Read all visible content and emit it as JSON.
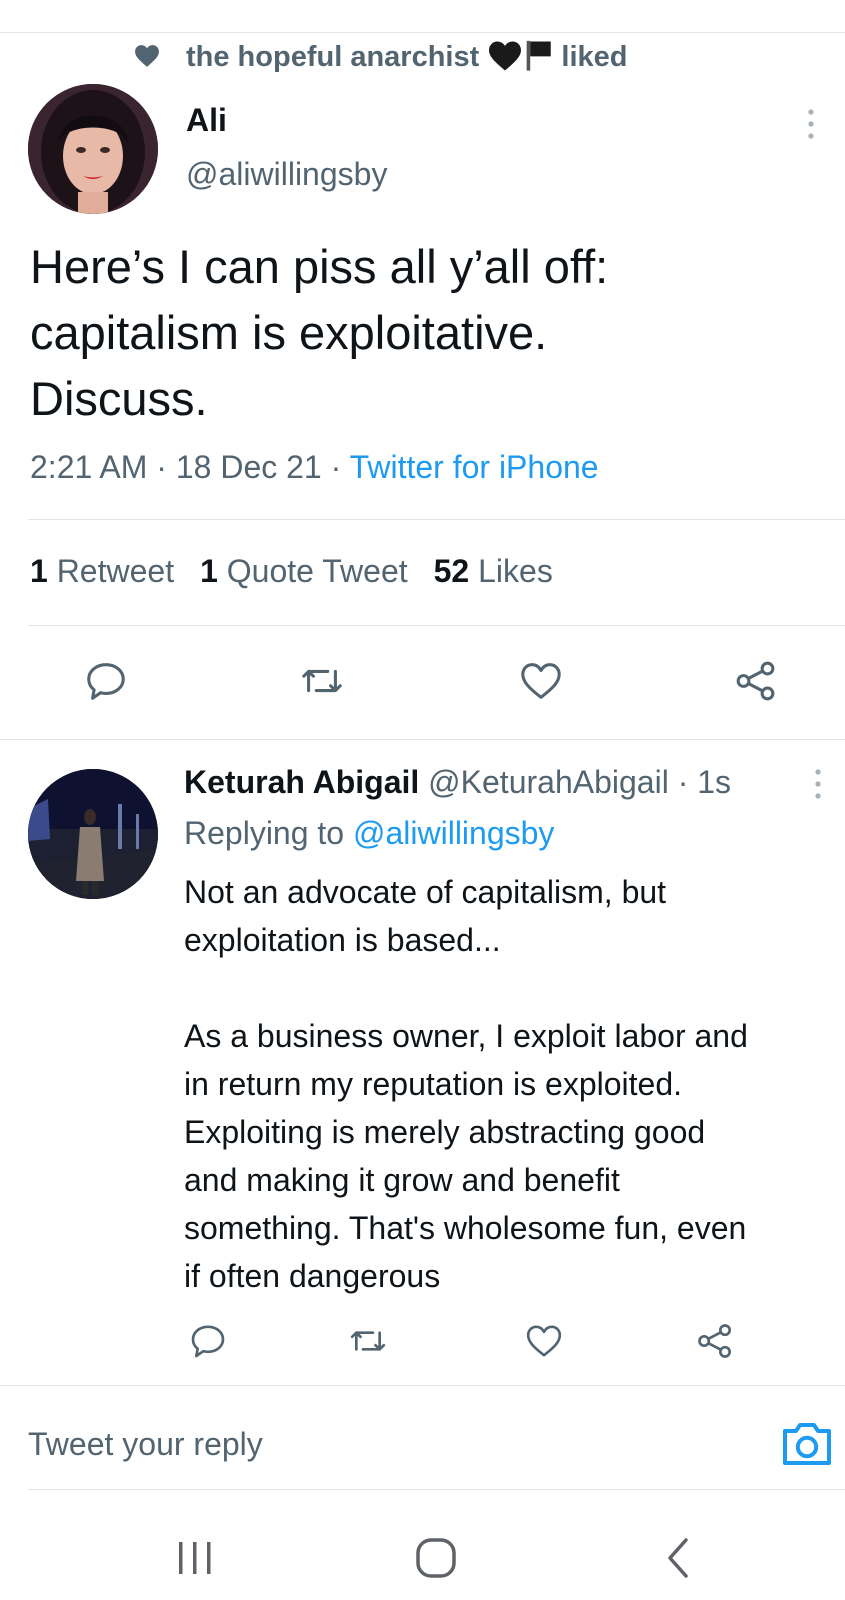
{
  "social_context": {
    "text": "the hopeful anarchist",
    "action": "liked"
  },
  "tweet": {
    "author_name": "Ali",
    "author_handle": "@aliwillingsby",
    "text_lines": [
      "Here’s I can piss all y’all off:",
      "capitalism is exploitative.",
      "Discuss."
    ],
    "time": "2:21 AM",
    "date": "18 Dec 21",
    "source": "Twitter for iPhone",
    "separator": " · ",
    "stats": {
      "retweets_count": "1",
      "retweets_label": "Retweet",
      "quotes_count": "1",
      "quotes_label": "Quote Tweet",
      "likes_count": "52",
      "likes_label": "Likes"
    }
  },
  "reply": {
    "author_name": "Keturah Abigail",
    "author_handle": "@KeturahAbigail",
    "age": "1s",
    "replying_prefix": "Replying to",
    "replying_to": "@aliwillingsby",
    "text_lines": [
      "Not an advocate of capitalism, but",
      "exploitation is based...",
      "",
      "As a business owner, I exploit labor and",
      "in return my reputation is exploited.",
      "Exploiting is merely abstracting good",
      "and making it grow and benefit",
      "something. That's wholesome fun, even",
      "if often dangerous"
    ]
  },
  "composer": {
    "placeholder": "Tweet your reply"
  },
  "icons": {
    "social_heart": "heart-icon",
    "emoji_heart": "black-heart-emoji",
    "emoji_flag": "black-flag-emoji",
    "more": "more-vertical-icon",
    "reply": "reply-icon",
    "retweet": "retweet-icon",
    "like": "heart-icon",
    "share": "share-icon",
    "camera": "camera-icon",
    "nav_recents": "recents-icon",
    "nav_home": "home-icon",
    "nav_back": "back-icon"
  },
  "colors": {
    "text_primary": "#0f1419",
    "text_secondary": "#536471",
    "accent": "#1d9bf0",
    "divider": "#e1e6ea"
  }
}
